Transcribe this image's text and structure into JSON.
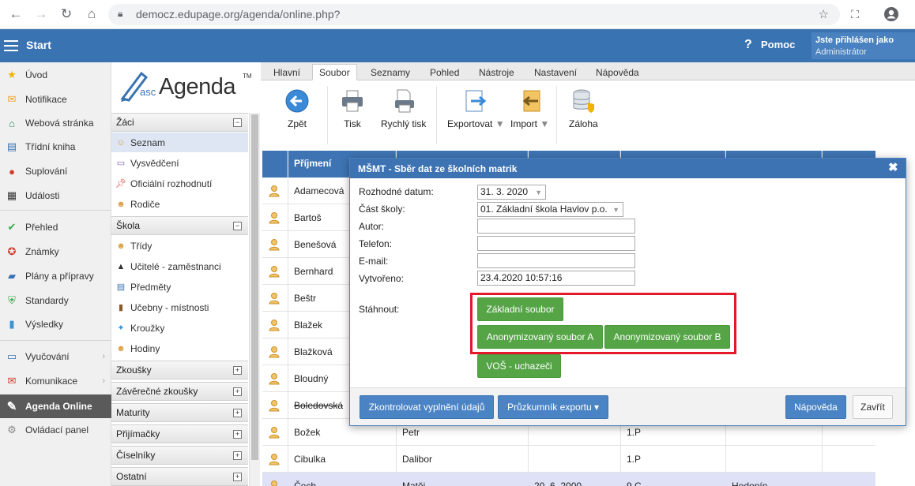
{
  "browser": {
    "url": "democz.edupage.org/agenda/online.php?"
  },
  "topbar": {
    "start_label": "Start",
    "help_label": "Pomoc",
    "user_line1": "Jste přihlášen jako",
    "user_line2": "Administrátor"
  },
  "leftnav": {
    "items": [
      {
        "label": "Úvod",
        "icon": "star-icon"
      },
      {
        "label": "Notifikace",
        "icon": "envelope-icon"
      },
      {
        "label": "Webová stránka",
        "icon": "home-icon"
      },
      {
        "label": "Třídní kniha",
        "icon": "book-icon"
      },
      {
        "label": "Suplování",
        "icon": "person-icon"
      },
      {
        "label": "Události",
        "icon": "calendar-icon"
      },
      {
        "label": "Přehled",
        "icon": "check-circle-icon"
      },
      {
        "label": "Známky",
        "icon": "grade-icon"
      },
      {
        "label": "Plány a přípravy",
        "icon": "briefcase-icon"
      },
      {
        "label": "Standardy",
        "icon": "shield-check-icon"
      },
      {
        "label": "Výsledky",
        "icon": "bar-chart-icon"
      },
      {
        "label": "Vyučování",
        "icon": "board-icon"
      },
      {
        "label": "Komunikace",
        "icon": "chat-icon"
      },
      {
        "label": "Agenda Online",
        "icon": "pen-icon"
      },
      {
        "label": "Ovládací panel",
        "icon": "gear-icon"
      }
    ]
  },
  "agenda": {
    "logo_prefix": "asc",
    "logo_text": "Agenda",
    "logo_tm": "TM",
    "sections": {
      "zaci": "Žáci",
      "skola": "Škola",
      "zkousky": "Zkoušky",
      "zaverecne": "Závěrečné zkoušky",
      "maturity": "Maturity",
      "prijimacky": "Přijímačky",
      "ciselniky": "Číselníky",
      "ostatni": "Ostatní"
    },
    "zaci_items": [
      "Seznam",
      "Vysvědčení",
      "Oficiální rozhodnutí",
      "Rodiče"
    ],
    "skola_items": [
      "Třídy",
      "Učitelé - zaměstnanci",
      "Předměty",
      "Učebny - místnosti",
      "Kroužky",
      "Hodiny"
    ]
  },
  "ribbon": {
    "tabs": [
      "Hlavní",
      "Soubor",
      "Seznamy",
      "Pohled",
      "Nástroje",
      "Nastavení",
      "Nápověda"
    ],
    "active_tab": "Soubor",
    "buttons": {
      "zpet": "Zpět",
      "tisk": "Tisk",
      "rychly_tisk": "Rychlý tisk",
      "exportovat": "Exportovat",
      "import": "Import",
      "zaloha": "Záloha"
    }
  },
  "grid": {
    "header_prijmeni": "Příjmení",
    "rows": [
      {
        "c1": "Adamecová",
        "c2": "",
        "c3": "",
        "c4": "",
        "c5": ""
      },
      {
        "c1": "Bartoš",
        "c2": "",
        "c3": "",
        "c4": "",
        "c5": ""
      },
      {
        "c1": "Benešová",
        "c2": "",
        "c3": "",
        "c4": "",
        "c5": ""
      },
      {
        "c1": "Bernhard",
        "c2": "",
        "c3": "",
        "c4": "",
        "c5": ""
      },
      {
        "c1": "Beštr",
        "c2": "",
        "c3": "",
        "c4": "",
        "c5": ""
      },
      {
        "c1": "Blažek",
        "c2": "",
        "c3": "",
        "c4": "",
        "c5": ""
      },
      {
        "c1": "Blažková",
        "c2": "",
        "c3": "",
        "c4": "",
        "c5": ""
      },
      {
        "c1": "Bloudný",
        "c2": "",
        "c3": "",
        "c4": "",
        "c5": ""
      },
      {
        "c1": "Boledovská",
        "c2": "",
        "c3": "",
        "c4": "",
        "c5": ""
      },
      {
        "c1": "Božek",
        "c2": "Petr",
        "c3": "",
        "c4": "1.P",
        "c5": ""
      },
      {
        "c1": "Cibulka",
        "c2": "Dalibor",
        "c3": "",
        "c4": "1.P",
        "c5": ""
      },
      {
        "c1": "Čech",
        "c2": "Matěj",
        "c3": "20. 6. 2000",
        "c4": "9.C",
        "c5": "Hodonín"
      }
    ]
  },
  "dialog": {
    "title": "MŠMT - Sběr dat ze školních matrik",
    "close_symbol": "✖",
    "labels": {
      "rozhodne_datum": "Rozhodné datum:",
      "cast_skoly": "Část školy:",
      "autor": "Autor:",
      "telefon": "Telefon:",
      "email": "E-mail:",
      "vytvoreno": "Vytvořeno:",
      "stahnout": "Stáhnout:"
    },
    "values": {
      "rozhodne_datum": "31. 3. 2020",
      "cast_skoly": "01. Základní škola Havlov p.o.",
      "autor": "",
      "telefon": "",
      "email": "",
      "vytvoreno": "23.4.2020 10:57:16"
    },
    "download_buttons": {
      "zakladni": "Základní soubor",
      "anon_a": "Anonymizovaný soubor A",
      "anon_b": "Anonymizovaný soubor B",
      "vos": "VOŠ - uchazeči"
    },
    "footer": {
      "zkontrolovat": "Zkontrolovat vyplnění údajů",
      "pruzkumnik": "Průzkumník exportu ▾",
      "napoveda": "Nápověda",
      "zavrit": "Zavřít"
    }
  },
  "colors": {
    "brand_blue": "#3a73b2",
    "green_button": "#55a546",
    "highlight_red": "#e5182a"
  }
}
